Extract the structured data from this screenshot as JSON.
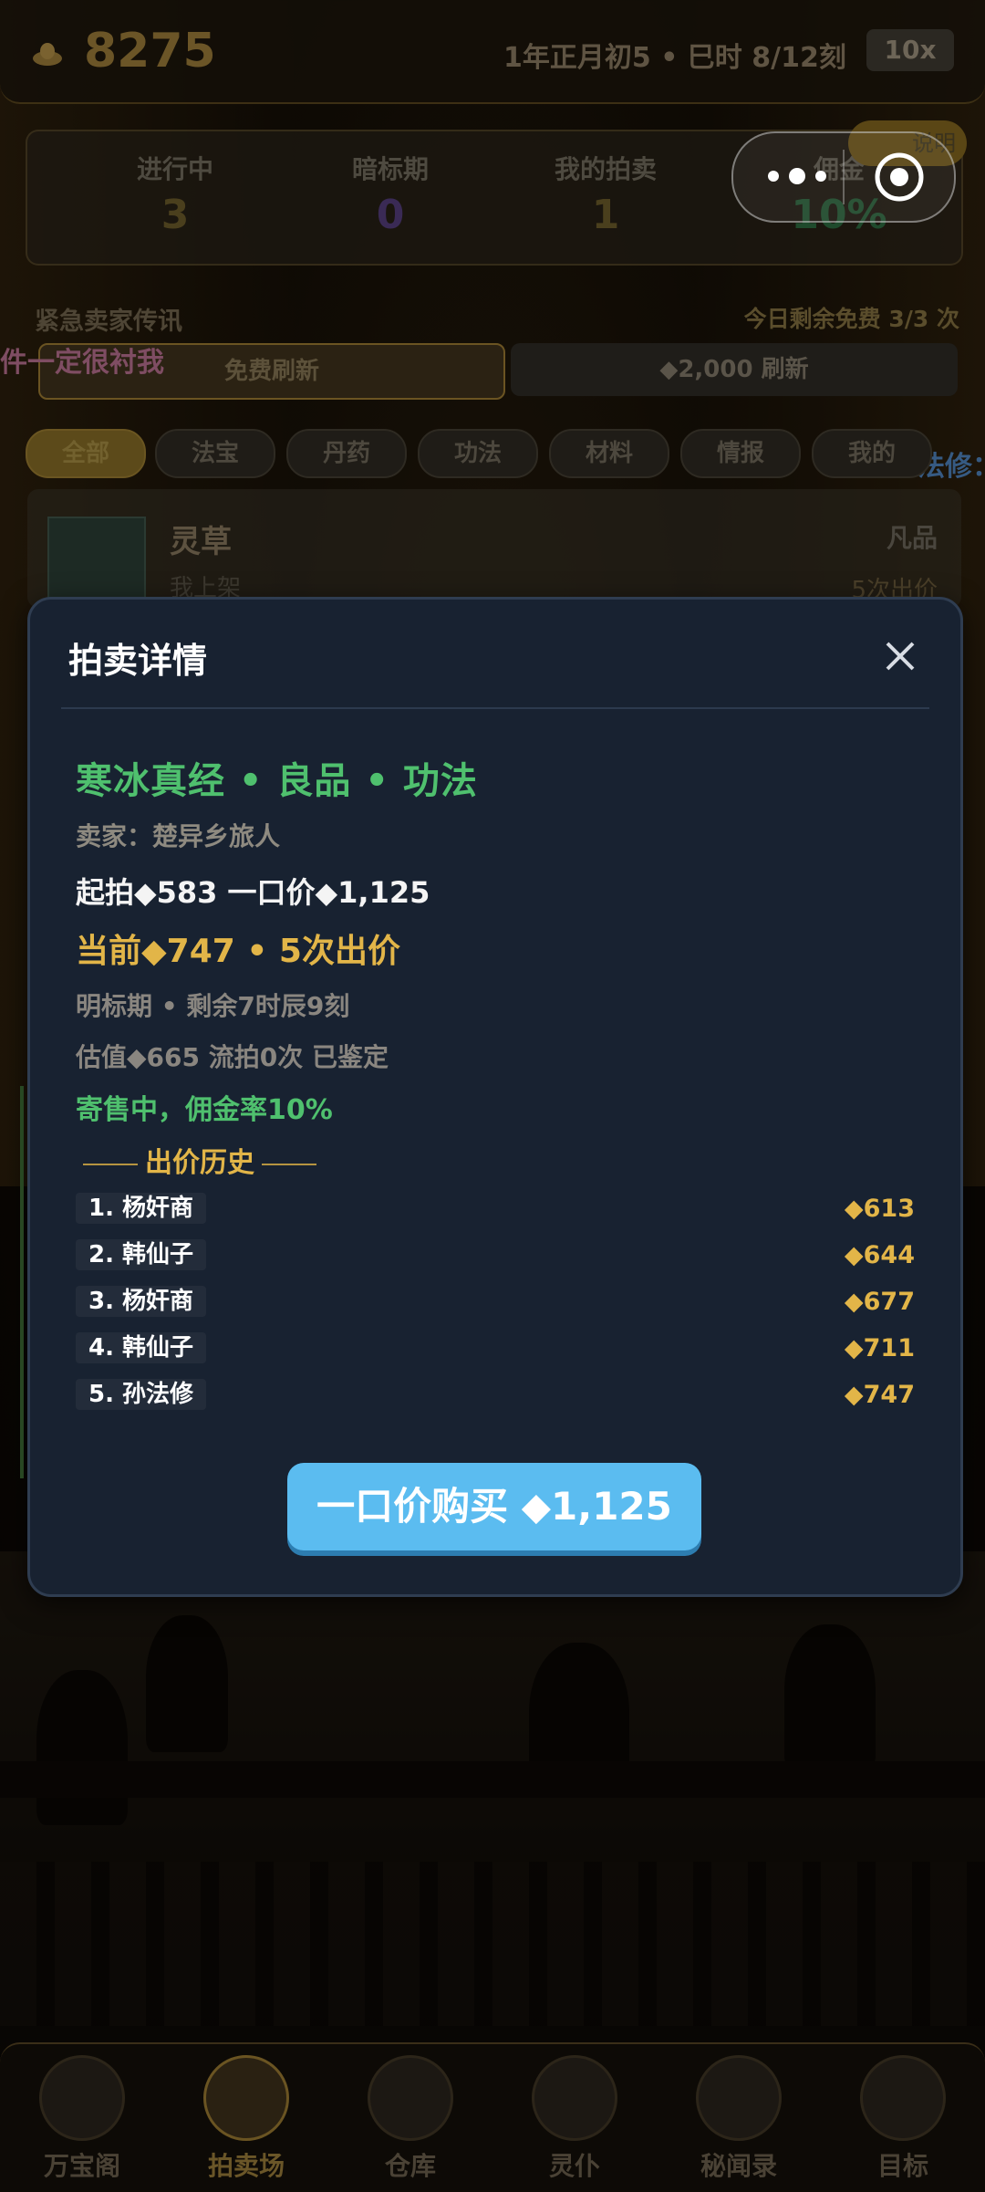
{
  "header": {
    "coins": "8275",
    "date": "1年正月初5 • 巳时 8/12刻",
    "speed": "10x",
    "coin_icon": "gold-ingot-icon"
  },
  "stats": [
    {
      "label": "进行中",
      "value": "3",
      "color": "#4a3f1d"
    },
    {
      "label": "暗标期",
      "value": "0",
      "color": "#3a2a55"
    },
    {
      "label": "我的拍卖",
      "value": "1",
      "color": "#4a3f1d"
    },
    {
      "label": "佣金",
      "value": "10%",
      "color": "#1f4a2c"
    }
  ],
  "help": "说明",
  "messenger": {
    "title": "紧急卖家传讯",
    "free_left": "今日剩余免费 3/3 次",
    "free_refresh": "免费刷新",
    "paid_refresh": "◆2,000 刷新"
  },
  "danmaku": [
    "件一定很衬我",
    "孙法修："
  ],
  "tabs": [
    "全部",
    "法宝",
    "丹药",
    "功法",
    "材料",
    "情报",
    "我的"
  ],
  "listing": {
    "name": "灵草",
    "sub": "我上架",
    "grade": "凡品",
    "bids": "5次出价"
  },
  "modal": {
    "title": "拍卖详情",
    "item_title": "寒冰真经 • 良品 • 功法",
    "seller": "卖家：楚异乡旅人",
    "prices": "起拍◆583  一口价◆1,125",
    "current": "当前◆747  •  5次出价",
    "phase": "明标期  •  剩余7时辰9刻",
    "estimate": "估值◆665  流拍0次  已鉴定",
    "consign": "寄售中，佣金率10%",
    "history_title": "出价历史",
    "history": [
      {
        "who": "1. 杨奸商",
        "amount": "◆613"
      },
      {
        "who": "2. 韩仙子",
        "amount": "◆644"
      },
      {
        "who": "3. 杨奸商",
        "amount": "◆677"
      },
      {
        "who": "4. 韩仙子",
        "amount": "◆711"
      },
      {
        "who": "5. 孙法修",
        "amount": "◆747"
      }
    ],
    "buy_button": "一口价购买 ◆1,125"
  },
  "nav": [
    {
      "label": "万宝阁",
      "icon": "treasure-orb-icon"
    },
    {
      "label": "拍卖场",
      "icon": "auction-crest-icon",
      "active": true
    },
    {
      "label": "仓库",
      "icon": "warehouse-icon"
    },
    {
      "label": "灵仆",
      "icon": "servant-icon"
    },
    {
      "label": "秘闻录",
      "icon": "book-icon"
    },
    {
      "label": "目标",
      "icon": "target-icon"
    }
  ]
}
